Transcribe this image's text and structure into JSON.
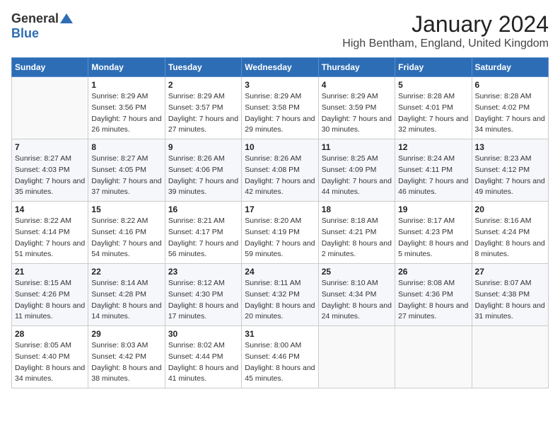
{
  "logo": {
    "general": "General",
    "blue": "Blue"
  },
  "title": {
    "month": "January 2024",
    "location": "High Bentham, England, United Kingdom"
  },
  "headers": [
    "Sunday",
    "Monday",
    "Tuesday",
    "Wednesday",
    "Thursday",
    "Friday",
    "Saturday"
  ],
  "weeks": [
    [
      {
        "day": "",
        "sunrise": "",
        "sunset": "",
        "daylight": ""
      },
      {
        "day": "1",
        "sunrise": "Sunrise: 8:29 AM",
        "sunset": "Sunset: 3:56 PM",
        "daylight": "Daylight: 7 hours and 26 minutes."
      },
      {
        "day": "2",
        "sunrise": "Sunrise: 8:29 AM",
        "sunset": "Sunset: 3:57 PM",
        "daylight": "Daylight: 7 hours and 27 minutes."
      },
      {
        "day": "3",
        "sunrise": "Sunrise: 8:29 AM",
        "sunset": "Sunset: 3:58 PM",
        "daylight": "Daylight: 7 hours and 29 minutes."
      },
      {
        "day": "4",
        "sunrise": "Sunrise: 8:29 AM",
        "sunset": "Sunset: 3:59 PM",
        "daylight": "Daylight: 7 hours and 30 minutes."
      },
      {
        "day": "5",
        "sunrise": "Sunrise: 8:28 AM",
        "sunset": "Sunset: 4:01 PM",
        "daylight": "Daylight: 7 hours and 32 minutes."
      },
      {
        "day": "6",
        "sunrise": "Sunrise: 8:28 AM",
        "sunset": "Sunset: 4:02 PM",
        "daylight": "Daylight: 7 hours and 34 minutes."
      }
    ],
    [
      {
        "day": "7",
        "sunrise": "Sunrise: 8:27 AM",
        "sunset": "Sunset: 4:03 PM",
        "daylight": "Daylight: 7 hours and 35 minutes."
      },
      {
        "day": "8",
        "sunrise": "Sunrise: 8:27 AM",
        "sunset": "Sunset: 4:05 PM",
        "daylight": "Daylight: 7 hours and 37 minutes."
      },
      {
        "day": "9",
        "sunrise": "Sunrise: 8:26 AM",
        "sunset": "Sunset: 4:06 PM",
        "daylight": "Daylight: 7 hours and 39 minutes."
      },
      {
        "day": "10",
        "sunrise": "Sunrise: 8:26 AM",
        "sunset": "Sunset: 4:08 PM",
        "daylight": "Daylight: 7 hours and 42 minutes."
      },
      {
        "day": "11",
        "sunrise": "Sunrise: 8:25 AM",
        "sunset": "Sunset: 4:09 PM",
        "daylight": "Daylight: 7 hours and 44 minutes."
      },
      {
        "day": "12",
        "sunrise": "Sunrise: 8:24 AM",
        "sunset": "Sunset: 4:11 PM",
        "daylight": "Daylight: 7 hours and 46 minutes."
      },
      {
        "day": "13",
        "sunrise": "Sunrise: 8:23 AM",
        "sunset": "Sunset: 4:12 PM",
        "daylight": "Daylight: 7 hours and 49 minutes."
      }
    ],
    [
      {
        "day": "14",
        "sunrise": "Sunrise: 8:22 AM",
        "sunset": "Sunset: 4:14 PM",
        "daylight": "Daylight: 7 hours and 51 minutes."
      },
      {
        "day": "15",
        "sunrise": "Sunrise: 8:22 AM",
        "sunset": "Sunset: 4:16 PM",
        "daylight": "Daylight: 7 hours and 54 minutes."
      },
      {
        "day": "16",
        "sunrise": "Sunrise: 8:21 AM",
        "sunset": "Sunset: 4:17 PM",
        "daylight": "Daylight: 7 hours and 56 minutes."
      },
      {
        "day": "17",
        "sunrise": "Sunrise: 8:20 AM",
        "sunset": "Sunset: 4:19 PM",
        "daylight": "Daylight: 7 hours and 59 minutes."
      },
      {
        "day": "18",
        "sunrise": "Sunrise: 8:18 AM",
        "sunset": "Sunset: 4:21 PM",
        "daylight": "Daylight: 8 hours and 2 minutes."
      },
      {
        "day": "19",
        "sunrise": "Sunrise: 8:17 AM",
        "sunset": "Sunset: 4:23 PM",
        "daylight": "Daylight: 8 hours and 5 minutes."
      },
      {
        "day": "20",
        "sunrise": "Sunrise: 8:16 AM",
        "sunset": "Sunset: 4:24 PM",
        "daylight": "Daylight: 8 hours and 8 minutes."
      }
    ],
    [
      {
        "day": "21",
        "sunrise": "Sunrise: 8:15 AM",
        "sunset": "Sunset: 4:26 PM",
        "daylight": "Daylight: 8 hours and 11 minutes."
      },
      {
        "day": "22",
        "sunrise": "Sunrise: 8:14 AM",
        "sunset": "Sunset: 4:28 PM",
        "daylight": "Daylight: 8 hours and 14 minutes."
      },
      {
        "day": "23",
        "sunrise": "Sunrise: 8:12 AM",
        "sunset": "Sunset: 4:30 PM",
        "daylight": "Daylight: 8 hours and 17 minutes."
      },
      {
        "day": "24",
        "sunrise": "Sunrise: 8:11 AM",
        "sunset": "Sunset: 4:32 PM",
        "daylight": "Daylight: 8 hours and 20 minutes."
      },
      {
        "day": "25",
        "sunrise": "Sunrise: 8:10 AM",
        "sunset": "Sunset: 4:34 PM",
        "daylight": "Daylight: 8 hours and 24 minutes."
      },
      {
        "day": "26",
        "sunrise": "Sunrise: 8:08 AM",
        "sunset": "Sunset: 4:36 PM",
        "daylight": "Daylight: 8 hours and 27 minutes."
      },
      {
        "day": "27",
        "sunrise": "Sunrise: 8:07 AM",
        "sunset": "Sunset: 4:38 PM",
        "daylight": "Daylight: 8 hours and 31 minutes."
      }
    ],
    [
      {
        "day": "28",
        "sunrise": "Sunrise: 8:05 AM",
        "sunset": "Sunset: 4:40 PM",
        "daylight": "Daylight: 8 hours and 34 minutes."
      },
      {
        "day": "29",
        "sunrise": "Sunrise: 8:03 AM",
        "sunset": "Sunset: 4:42 PM",
        "daylight": "Daylight: 8 hours and 38 minutes."
      },
      {
        "day": "30",
        "sunrise": "Sunrise: 8:02 AM",
        "sunset": "Sunset: 4:44 PM",
        "daylight": "Daylight: 8 hours and 41 minutes."
      },
      {
        "day": "31",
        "sunrise": "Sunrise: 8:00 AM",
        "sunset": "Sunset: 4:46 PM",
        "daylight": "Daylight: 8 hours and 45 minutes."
      },
      {
        "day": "",
        "sunrise": "",
        "sunset": "",
        "daylight": ""
      },
      {
        "day": "",
        "sunrise": "",
        "sunset": "",
        "daylight": ""
      },
      {
        "day": "",
        "sunrise": "",
        "sunset": "",
        "daylight": ""
      }
    ]
  ]
}
